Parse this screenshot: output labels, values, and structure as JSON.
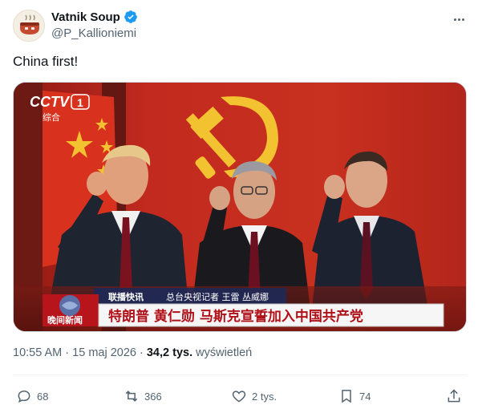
{
  "author": {
    "display_name": "Vatnik Soup",
    "handle": "@P_Kallioniemi",
    "verified_icon": "verified-badge-icon",
    "avatar_icon": "soup-bowl-avatar-icon"
  },
  "tweet": {
    "text": "China first!"
  },
  "media": {
    "channel_logo": "CCTV",
    "channel_number": "1",
    "channel_sub": "综合",
    "ticker_left_top": "联播快讯",
    "ticker_left_bottom": "晚间新闻",
    "reporter_line": "总台央视记者 王雷 丛威娜",
    "headline": "特朗普 黄仁勋 马斯克宣誓加入中国共产党"
  },
  "meta": {
    "time": "10:55 AM",
    "separator": " · ",
    "date": "15 maj 2026",
    "separator2": " · ",
    "views_count": "34,2 tys.",
    "views_label": " wyświetleń"
  },
  "actions": {
    "replies": "68",
    "reposts": "366",
    "likes": "2 tys.",
    "bookmarks": "74"
  },
  "colors": {
    "text_primary": "#0f1419",
    "text_secondary": "#536471",
    "verified_blue": "#1d9bf0",
    "flag_red": "#c8281e",
    "emblem_gold": "#f2c230"
  }
}
